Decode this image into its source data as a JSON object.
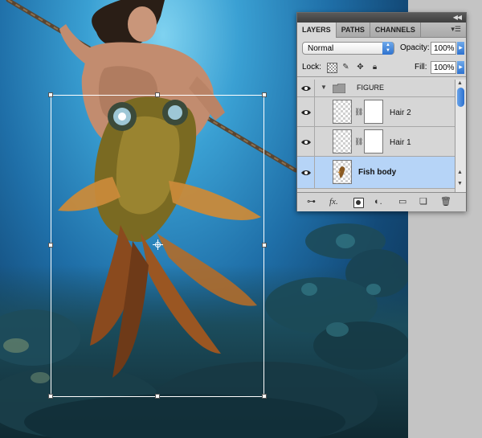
{
  "panel": {
    "tabs": [
      {
        "label": "LAYERS",
        "active": true
      },
      {
        "label": "PATHS",
        "active": false
      },
      {
        "label": "CHANNELS",
        "active": false
      }
    ],
    "blend_mode": "Normal",
    "opacity_label": "Opacity:",
    "opacity_value": "100%",
    "lock_label": "Lock:",
    "fill_label": "Fill:",
    "fill_value": "100%",
    "layers": [
      {
        "name": "FIGURE",
        "type": "group",
        "expanded": true,
        "visible": true
      },
      {
        "name": "Hair 2",
        "type": "layer-with-mask",
        "visible": true
      },
      {
        "name": "Hair 1",
        "type": "layer-with-mask",
        "visible": true
      },
      {
        "name": "Fish body",
        "type": "layer",
        "visible": true,
        "selected": true
      }
    ],
    "footer_icons": [
      "link-layers-icon",
      "fx-icon",
      "add-mask-icon",
      "adjustment-layer-icon",
      "new-group-icon",
      "new-layer-icon",
      "trash-icon"
    ],
    "footer_fx_label": "fx."
  },
  "colors": {
    "selection_highlight": "#b6d4f7",
    "accent_blue": "#2e72cf"
  }
}
